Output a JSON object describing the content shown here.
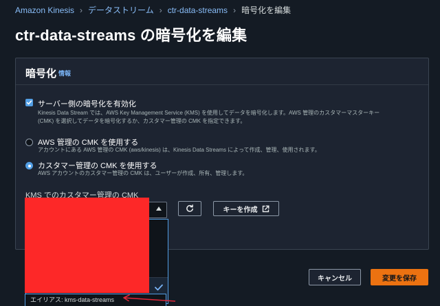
{
  "breadcrumb": {
    "items": [
      "Amazon Kinesis",
      "データストリーム",
      "ctr-data-streams"
    ],
    "current": "暗号化を編集"
  },
  "page": {
    "title": "ctr-data-streams の暗号化を編集"
  },
  "encryption": {
    "title": "暗号化",
    "info_label": "情報",
    "server_side": {
      "label": "サーバー側の暗号化を有効化",
      "checked": true,
      "description_line1": "Kinesis Data Stream では、AWS Key Management Service (KMS) を使用してデータを暗号化します。AWS 管理のカスタマーマスターキー",
      "description_line2": "(CMK) を選択してデータを暗号化するか、カスタマー管理の CMK を指定できます。"
    },
    "options": [
      {
        "label": "AWS 管理の CMK を使用する",
        "description": "アカウントにある AWS 管理の CMK (aws/kinesis) は、Kinesis Data Streams によって作成、管理、使用されます。",
        "selected": false
      },
      {
        "label": "カスタマー管理の CMK を使用する",
        "description": "AWS アカウントのカスタマー管理の CMK は、ユーザーが作成、所有、管理します。",
        "selected": true
      }
    ],
    "kms_key": {
      "label": "KMS でのカスタマー管理の CMK",
      "refresh_icon": "refresh-icon",
      "create_key_label": "キーを作成",
      "external_icon": "external-link-icon",
      "selected_alias": "エイリアス: kms-data-streams"
    }
  },
  "footer": {
    "cancel_label": "キャンセル",
    "save_label": "変更を保存"
  },
  "colors": {
    "accent": "#539fe5",
    "primary_button": "#ec7211",
    "redaction": "#fd2828",
    "annotation_arrow": "#e0283a"
  }
}
